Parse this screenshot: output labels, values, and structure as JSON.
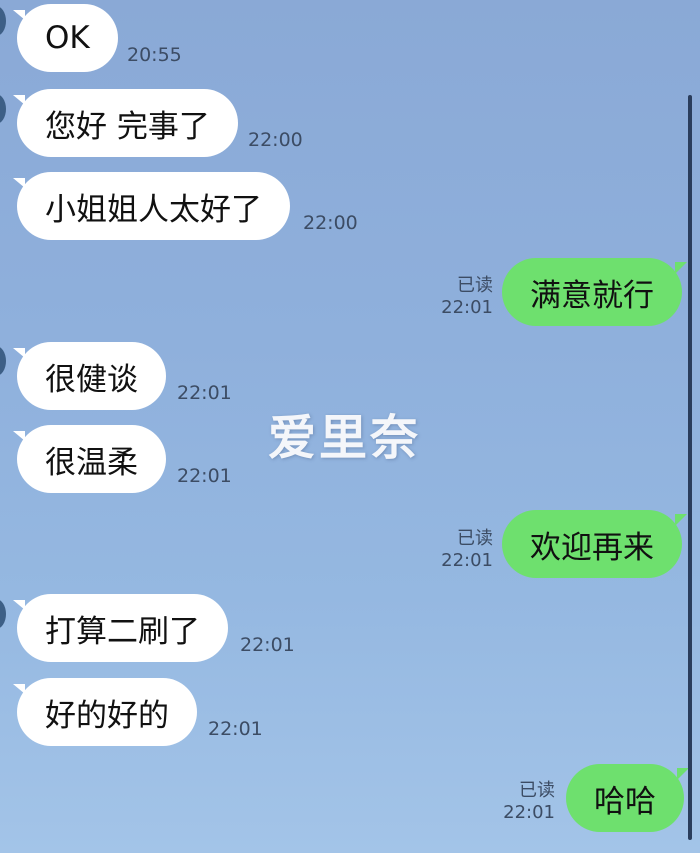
{
  "messages": [
    {
      "text": "OK",
      "time": "20:55"
    },
    {
      "text": "您好 完事了",
      "time": "22:00"
    },
    {
      "text": "小姐姐人太好了",
      "time": "22:00"
    },
    {
      "text": "满意就行",
      "time": "22:01",
      "read": "已读"
    },
    {
      "text": "很健谈",
      "time": "22:01"
    },
    {
      "text": "很温柔",
      "time": "22:01"
    },
    {
      "text": "欢迎再来",
      "time": "22:01",
      "read": "已读"
    },
    {
      "text": "打算二刷了",
      "time": "22:01"
    },
    {
      "text": "好的好的",
      "time": "22:01"
    },
    {
      "text": "哈哈",
      "time": "22:01",
      "read": "已读"
    }
  ],
  "watermark": "爱里奈",
  "colors": {
    "incoming": "#ffffff",
    "outgoing": "#6ee06e",
    "background": "#8fb0dc"
  }
}
